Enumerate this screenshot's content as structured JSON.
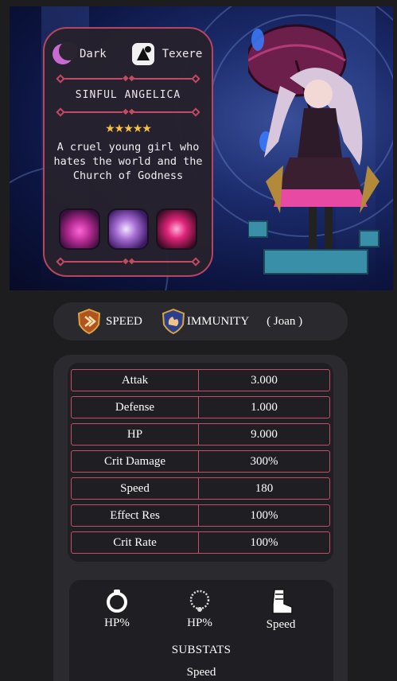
{
  "hero": {
    "element": "Dark",
    "class": "Texere",
    "name": "SINFUL ANGELICA",
    "stars": "★★★★★",
    "description": "A cruel young girl who hates the world and the Church of Godness",
    "skills": [
      "skill-1",
      "skill-2",
      "skill-3"
    ]
  },
  "sets": {
    "set1": "SPEED",
    "set2": "IMMUNITY",
    "artifact": "( Joan )"
  },
  "stats": [
    {
      "label": "Attak",
      "value": "3.000"
    },
    {
      "label": "Defense",
      "value": "1.000"
    },
    {
      "label": "HP",
      "value": "9.000"
    },
    {
      "label": "Crit Damage",
      "value": "300%"
    },
    {
      "label": "Speed",
      "value": "180"
    },
    {
      "label": "Effect Res",
      "value": "100%"
    },
    {
      "label": "Crit Rate",
      "value": "100%"
    }
  ],
  "main_stats": {
    "ring": "HP%",
    "necklace": "HP%",
    "boots": "Speed"
  },
  "substats": {
    "title": "SUBSTATS",
    "first": "Speed"
  },
  "colors": {
    "accent": "#c44d68",
    "star": "#f5c242",
    "panel": "#2b2b2f"
  }
}
